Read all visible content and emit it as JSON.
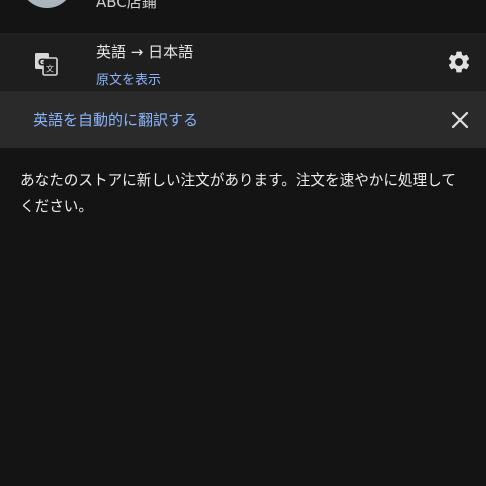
{
  "header": {
    "avatar_icon": "user-avatar",
    "partial_title": "ABC店鋪"
  },
  "translate_bar": {
    "icon": "google-translate-icon",
    "lang_pair": "英語 → 日本語",
    "show_original": "原文を表示",
    "settings_icon": "gear-icon"
  },
  "auto_translate_bar": {
    "label": "英語を自動的に翻訳する",
    "close_icon": "close-icon"
  },
  "message": {
    "body": "あなたのストアに新しい注文があります。注文を速やかに処理してください。"
  },
  "colors": {
    "background": "#141414",
    "translate_bar": "#1e1e1e",
    "auto_bar": "#2a2a2a",
    "link": "#8ab4f8",
    "text": "#ececec"
  }
}
